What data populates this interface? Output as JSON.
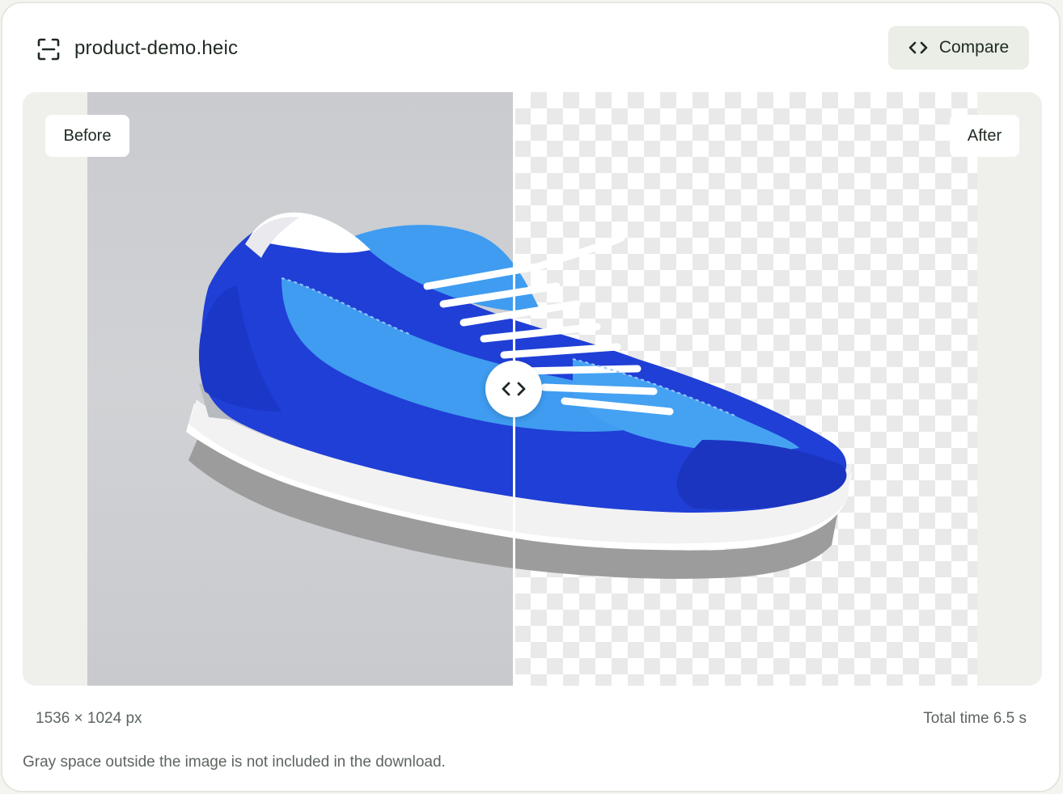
{
  "header": {
    "file_icon": "scan-frame-icon",
    "file_name": "product-demo.heic",
    "compare_icon": "code-brackets-icon",
    "compare_label": "Compare"
  },
  "comparison": {
    "before_label": "Before",
    "after_label": "After",
    "slider_icon": "chevrons-left-right-icon",
    "slider_position": 0.48,
    "colors": {
      "before_background": "#ccced2",
      "shoe_primary": "#1f3fd6",
      "shoe_mesh": "#3f9cf0",
      "sole": "#ffffff",
      "outsole": "#9a9a9a"
    }
  },
  "footer": {
    "dimensions": "1536 × 1024 px",
    "total_time": "Total time 6.5 s",
    "note": "Gray space outside the image is not included in the download."
  }
}
